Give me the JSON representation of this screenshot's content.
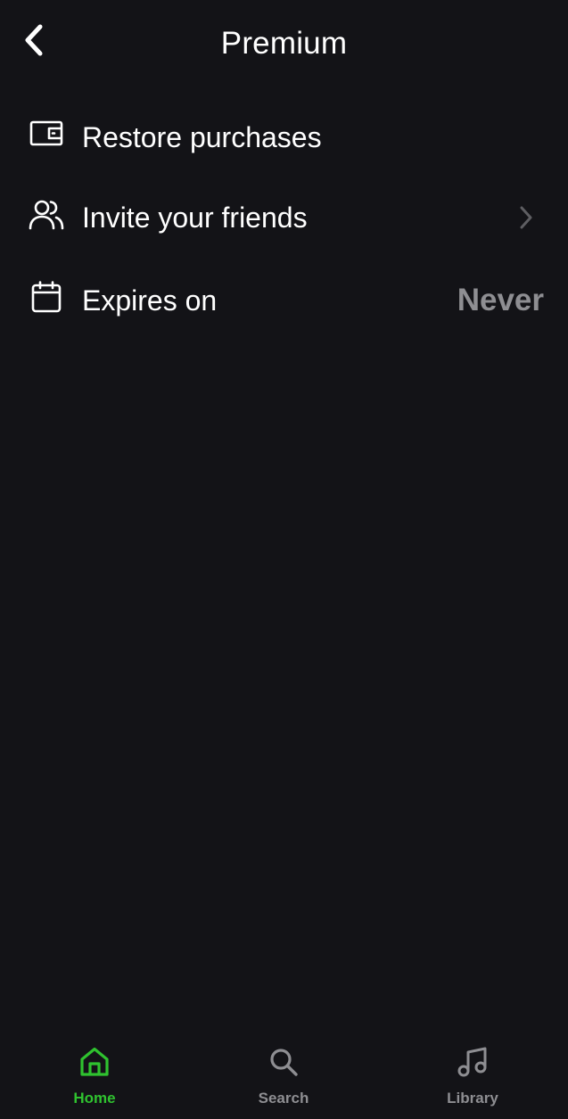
{
  "header": {
    "title": "Premium",
    "back_icon": "chevron-left-icon"
  },
  "menu": {
    "items": [
      {
        "label": "Restore purchases",
        "icon": "wallet-icon"
      },
      {
        "label": "Invite your friends",
        "icon": "users-icon",
        "trailing_icon": "chevron-right-icon"
      },
      {
        "label": "Expires on",
        "icon": "calendar-icon",
        "value": "Never"
      }
    ]
  },
  "bottom_nav": {
    "items": [
      {
        "label": "Home",
        "icon": "home-icon",
        "active": true
      },
      {
        "label": "Search",
        "icon": "search-icon",
        "active": false
      },
      {
        "label": "Library",
        "icon": "music-note-icon",
        "active": false
      }
    ]
  },
  "colors": {
    "background": "#131317",
    "text": "#ffffff",
    "muted": "#8e8e92",
    "accent": "#2fc22f"
  }
}
